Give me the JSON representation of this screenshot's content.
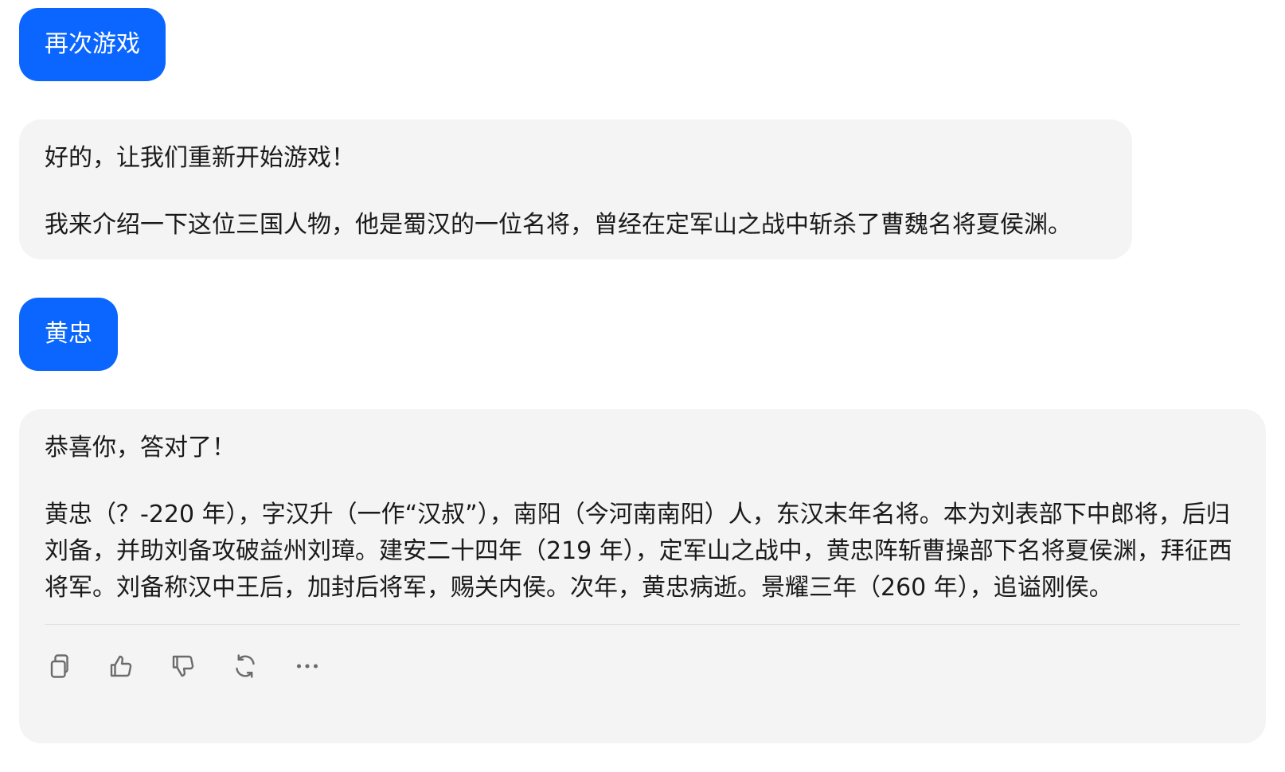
{
  "messages": [
    {
      "role": "user",
      "text": "再次游戏"
    },
    {
      "role": "assistant",
      "paragraphs": [
        "好的，让我们重新开始游戏！",
        "我来介绍一下这位三国人物，他是蜀汉的一位名将，曾经在定军山之战中斩杀了曹魏名将夏侯渊。"
      ]
    },
    {
      "role": "user",
      "text": "黄忠"
    },
    {
      "role": "assistant",
      "paragraphs": [
        "恭喜你，答对了！",
        "黄忠（？-220 年），字汉升（一作“汉叔”），南阳（今河南南阳）人，东汉末年名将。本为刘表部下中郎将，后归刘备，并助刘备攻破益州刘璋。建安二十四年（219 年），定军山之战中，黄忠阵斩曹操部下名将夏侯渊，拜征西将军。刘备称汉中王后，加封后将军，赐关内侯。次年，黄忠病逝。景耀三年（260 年），追谥刚侯。"
      ]
    }
  ],
  "actions": [
    {
      "icon": "copy-icon"
    },
    {
      "icon": "thumbs-up-icon"
    },
    {
      "icon": "thumbs-down-icon"
    },
    {
      "icon": "refresh-icon"
    },
    {
      "icon": "more-icon"
    }
  ],
  "colors": {
    "user_bubble": "#0a66ff",
    "bot_bubble": "#f4f4f4",
    "icon": "#6b6b6b"
  }
}
